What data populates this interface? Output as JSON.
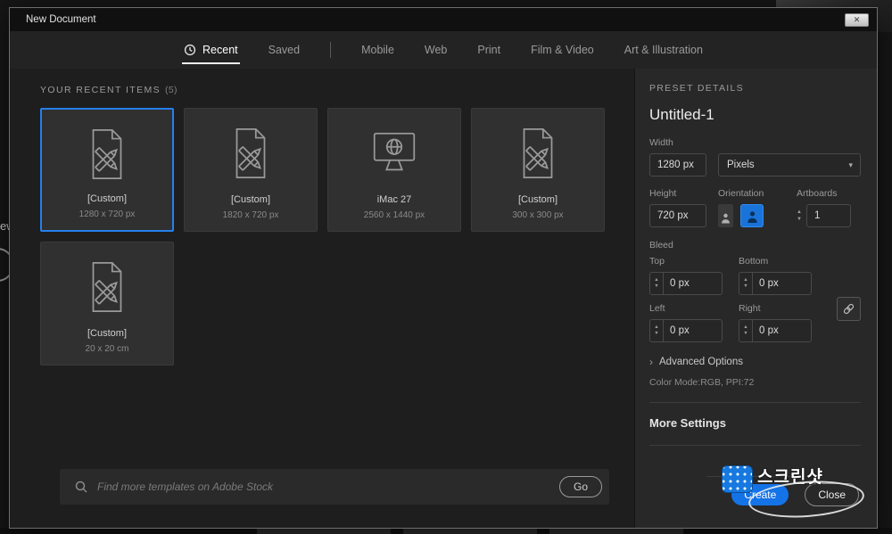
{
  "window": {
    "title": "New Document"
  },
  "icons": {
    "close": "✕",
    "chevron_down": "▾",
    "chevron_right": "›",
    "arrow_up": "▲",
    "arrow_down": "▼"
  },
  "tabs": [
    {
      "label": "Recent"
    },
    {
      "label": "Saved"
    },
    {
      "label": "Mobile"
    },
    {
      "label": "Web"
    },
    {
      "label": "Print"
    },
    {
      "label": "Film & Video"
    },
    {
      "label": "Art & Illustration"
    }
  ],
  "recent": {
    "header": "YOUR RECENT ITEMS",
    "count": "(5)",
    "items": [
      {
        "name": "[Custom]",
        "dims": "1280 x 720 px",
        "icon": "document",
        "selected": true
      },
      {
        "name": "[Custom]",
        "dims": "1820 x 720 px",
        "icon": "document",
        "selected": false
      },
      {
        "name": "iMac 27",
        "dims": "2560 x 1440 px",
        "icon": "display-globe",
        "selected": false
      },
      {
        "name": "[Custom]",
        "dims": "300 x 300 px",
        "icon": "document",
        "selected": false
      },
      {
        "name": "[Custom]",
        "dims": "20 x 20 cm",
        "icon": "document",
        "selected": false
      }
    ]
  },
  "search": {
    "placeholder": "Find more templates on Adobe Stock",
    "go": "Go"
  },
  "preset": {
    "header": "PRESET DETAILS",
    "name": "Untitled-1",
    "width_label": "Width",
    "width_value": "1280 px",
    "unit": "Pixels",
    "height_label": "Height",
    "height_value": "720 px",
    "orientation_label": "Orientation",
    "artboards_label": "Artboards",
    "artboards_value": "1",
    "bleed_label": "Bleed",
    "bleed_top_label": "Top",
    "bleed_top": "0 px",
    "bleed_bottom_label": "Bottom",
    "bleed_bottom": "0 px",
    "bleed_left_label": "Left",
    "bleed_left": "0 px",
    "bleed_right_label": "Right",
    "bleed_right": "0 px",
    "advanced": "Advanced Options",
    "color_mode": "Color Mode:RGB, PPI:72",
    "more_settings": "More Settings",
    "create": "Create",
    "close": "Close"
  },
  "background": {
    "fragment": "ew"
  },
  "watermark": {
    "text": "스크린샷"
  },
  "colors": {
    "accent": "#1473e6",
    "selection": "#2680eb"
  }
}
